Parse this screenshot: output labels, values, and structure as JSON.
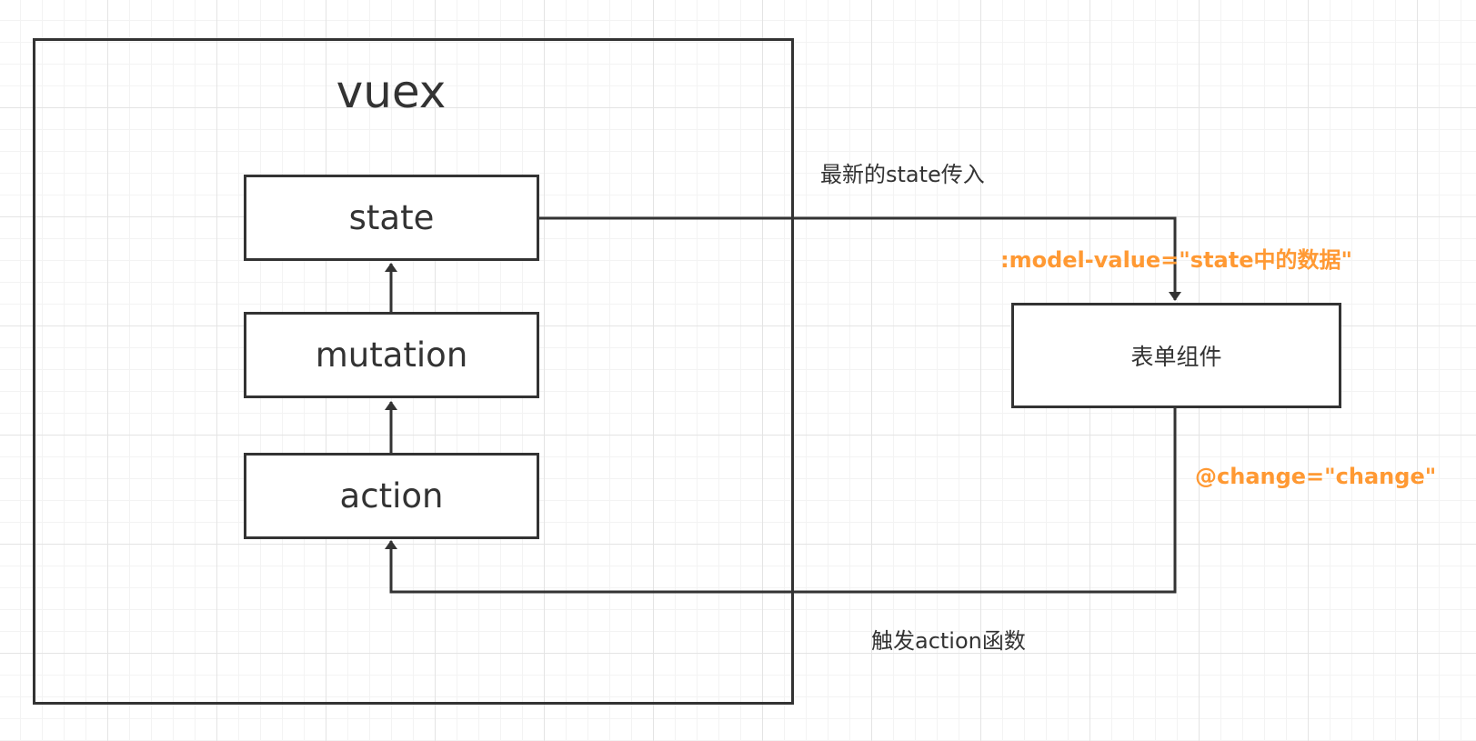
{
  "accent_color": "#ff9933",
  "line_color": "#333333",
  "vuex_box": {
    "title": "vuex",
    "nodes": {
      "state": "state",
      "mutation": "mutation",
      "action": "action"
    }
  },
  "form_component": {
    "label": "表单组件"
  },
  "edges": {
    "state_to_form": "最新的state传入",
    "form_to_action": "触发action函数"
  },
  "bindings": {
    "model_value": ":model-value=\"state中的数据\"",
    "change": "@change=\"change\""
  }
}
